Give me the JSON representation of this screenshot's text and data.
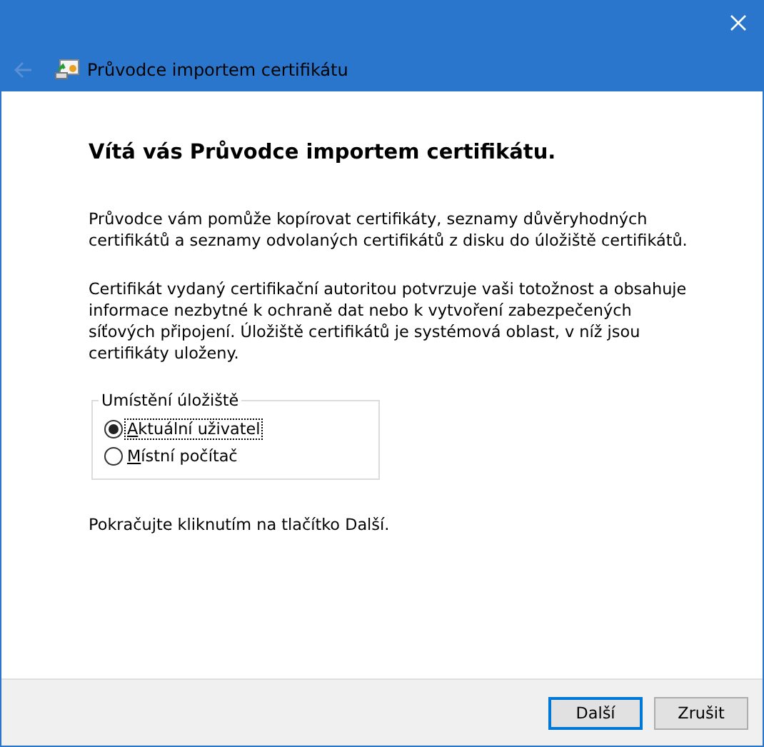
{
  "window": {
    "title": "Průvodce importem certifikátu"
  },
  "heading": "Vítá vás Průvodce importem certifikátu.",
  "paragraphs": [
    "Průvodce vám pomůže kopírovat certifikáty, seznamy důvěryhodných certifikátů a seznamy odvolaných certifikátů z disku do úložiště certifikátů.",
    "Certifikát vydaný certifikační autoritou potvrzuje vaši totožnost a obsahuje informace nezbytné k ochraně dat nebo k vytvoření zabezpečených síťových připojení. Úložiště certifikátů je systémová oblast, v níž jsou certifikáty uloženy."
  ],
  "store_location": {
    "label": "Umístění úložiště",
    "options": [
      {
        "label": "Aktuální uživatel",
        "selected": true
      },
      {
        "label": "Místní počítač",
        "selected": false
      }
    ]
  },
  "hint": "Pokračujte kliknutím na tlačítko Další.",
  "buttons": [
    {
      "label": "Další",
      "default": true
    },
    {
      "label": "Zrušit",
      "default": false
    }
  ]
}
